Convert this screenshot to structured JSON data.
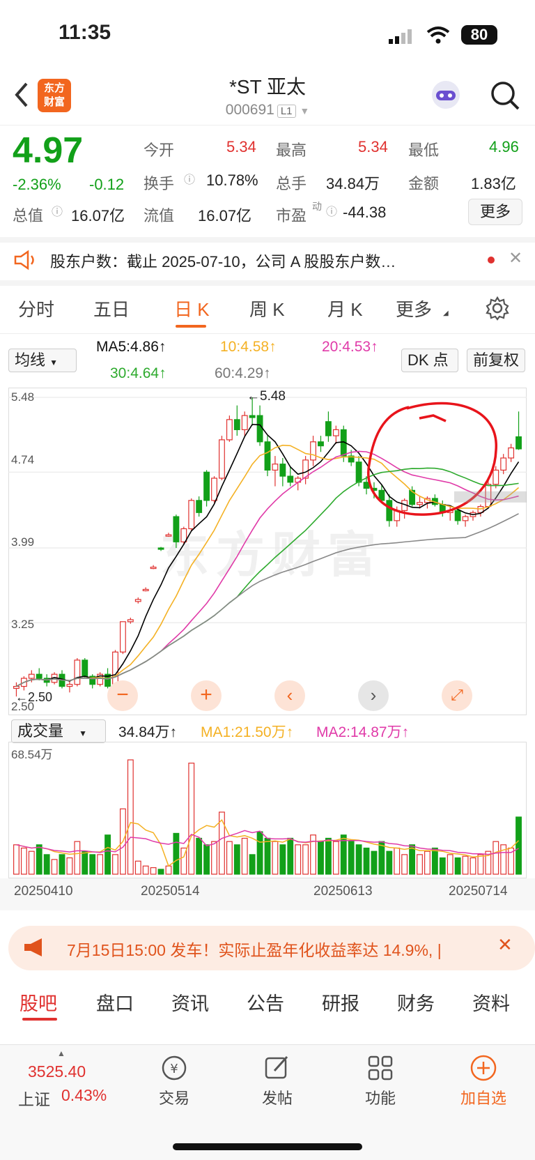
{
  "status_bar": {
    "time": "11:35",
    "battery": "80"
  },
  "header": {
    "logo_text": "东方\n财富",
    "title": "*ST 亚太",
    "code": "000691",
    "level": "L1"
  },
  "quote": {
    "price": "4.97",
    "change_pct": "-2.36%",
    "change": "-0.12",
    "open_label": "今开",
    "open": "5.34",
    "high_label": "最高",
    "high": "5.34",
    "low_label": "最低",
    "low": "4.96",
    "turnover_label": "换手",
    "turnover": "10.78%",
    "volume_label": "总手",
    "volume": "34.84万",
    "amount_label": "金额",
    "amount": "1.83亿",
    "mcap_label": "总值",
    "mcap": "16.07亿",
    "float_label": "流值",
    "float": "16.07亿",
    "pe_label": "市盈",
    "pe_sup": "动",
    "pe": "-44.38",
    "more": "更多"
  },
  "notice": {
    "text": "股东户数：截止 2025-07-10，公司 A 股股东户数…"
  },
  "period_tabs": [
    "分时",
    "五日",
    "日 K",
    "周 K",
    "月 K",
    "更多"
  ],
  "period_active": "日 K",
  "ma": {
    "selector": "均线",
    "ma5": "MA5:4.86↑",
    "ma10": "10:4.58↑",
    "ma20": "20:4.53↑",
    "ma30": "30:4.64↑",
    "ma60": "60:4.29↑",
    "dk": "DK 点",
    "adjust": "前复权"
  },
  "price_axis": [
    "5.48",
    "4.74",
    "3.99",
    "3.25",
    "2.50"
  ],
  "peak_label": "←5.48",
  "low_label": "←2.50",
  "watermark": "东方财富",
  "volume": {
    "selector": "成交量",
    "value": "34.84万↑",
    "ma1": "MA1:21.50万↑",
    "ma2": "MA2:14.87万↑",
    "max": "68.54万"
  },
  "dates": [
    "20250410",
    "20250514",
    "20250613",
    "20250714"
  ],
  "promo": {
    "text": "7月15日15:00 发车！实际止盈年化收益率达 14.9%, |"
  },
  "bottom_tabs": [
    "股吧",
    "盘口",
    "资讯",
    "公告",
    "研报",
    "财务",
    "资料"
  ],
  "bottom_active": "股吧",
  "bottom_nav": {
    "index_value": "3525.40",
    "index_name": "上证",
    "index_change": "0.43%",
    "items": [
      "交易",
      "发帖",
      "功能",
      "加自选"
    ]
  },
  "colors": {
    "up": "#e0312f",
    "down": "#12a019",
    "accent": "#f2661f",
    "ma5": "#000000",
    "ma10": "#f4b124",
    "ma20": "#e03aa8",
    "ma30": "#2daa2d",
    "ma60": "#888888"
  },
  "chart_data": {
    "type": "candlestick",
    "price_range": [
      2.5,
      5.48
    ],
    "candles": [
      [
        2.6,
        2.66,
        2.52,
        2.62
      ],
      [
        2.62,
        2.72,
        2.58,
        2.7
      ],
      [
        2.7,
        2.78,
        2.66,
        2.74
      ],
      [
        2.74,
        2.8,
        2.68,
        2.7
      ],
      [
        2.7,
        2.74,
        2.62,
        2.66
      ],
      [
        2.66,
        2.76,
        2.64,
        2.74
      ],
      [
        2.74,
        2.78,
        2.6,
        2.62
      ],
      [
        2.62,
        2.68,
        2.56,
        2.64
      ],
      [
        2.64,
        2.9,
        2.62,
        2.88
      ],
      [
        2.88,
        2.9,
        2.7,
        2.72
      ],
      [
        2.72,
        2.74,
        2.6,
        2.64
      ],
      [
        2.64,
        2.76,
        2.62,
        2.74
      ],
      [
        2.74,
        2.8,
        2.6,
        2.62
      ],
      [
        2.62,
        2.98,
        2.6,
        2.96
      ],
      [
        2.96,
        3.26,
        2.94,
        3.26
      ],
      [
        3.26,
        3.3,
        3.24,
        3.28
      ],
      [
        3.46,
        3.5,
        3.44,
        3.48
      ],
      [
        3.58,
        3.6,
        3.56,
        3.58
      ],
      [
        3.8,
        3.82,
        3.78,
        3.8
      ],
      [
        3.99,
        4.0,
        3.96,
        3.98
      ],
      [
        4.12,
        4.14,
        4.1,
        4.12
      ],
      [
        4.3,
        4.32,
        3.99,
        4.05
      ],
      [
        4.05,
        4.2,
        4.02,
        4.18
      ],
      [
        4.18,
        4.48,
        4.16,
        4.46
      ],
      [
        4.46,
        4.5,
        4.3,
        4.34
      ],
      [
        4.74,
        4.76,
        4.4,
        4.46
      ],
      [
        4.46,
        4.7,
        4.44,
        4.68
      ],
      [
        4.68,
        5.1,
        4.66,
        5.06
      ],
      [
        5.06,
        5.3,
        5.04,
        5.26
      ],
      [
        5.26,
        5.4,
        5.1,
        5.16
      ],
      [
        5.16,
        5.34,
        5.1,
        5.3
      ],
      [
        5.3,
        5.48,
        5.2,
        5.28
      ],
      [
        5.3,
        5.4,
        5.0,
        5.04
      ],
      [
        5.04,
        5.1,
        4.7,
        4.76
      ],
      [
        4.76,
        4.9,
        4.6,
        4.82
      ],
      [
        4.82,
        4.88,
        4.6,
        4.7
      ],
      [
        4.7,
        4.8,
        4.6,
        4.64
      ],
      [
        4.64,
        4.7,
        4.56,
        4.68
      ],
      [
        4.68,
        4.9,
        4.62,
        4.86
      ],
      [
        4.86,
        5.1,
        4.8,
        5.04
      ],
      [
        5.04,
        5.1,
        4.94,
        5.0
      ],
      [
        5.24,
        5.34,
        5.04,
        5.1
      ],
      [
        5.1,
        5.2,
        5.02,
        5.16
      ],
      [
        5.16,
        5.2,
        4.84,
        4.9
      ],
      [
        4.9,
        4.96,
        4.8,
        4.84
      ],
      [
        4.84,
        4.9,
        4.6,
        4.64
      ],
      [
        4.64,
        4.7,
        4.52,
        4.58
      ],
      [
        4.58,
        4.64,
        4.48,
        4.56
      ],
      [
        4.56,
        4.62,
        4.44,
        4.46
      ],
      [
        4.46,
        4.52,
        4.2,
        4.26
      ],
      [
        4.26,
        4.4,
        4.2,
        4.36
      ],
      [
        4.36,
        4.48,
        4.28,
        4.46
      ],
      [
        4.56,
        4.6,
        4.4,
        4.42
      ],
      [
        4.42,
        4.5,
        4.38,
        4.44
      ],
      [
        4.44,
        4.5,
        4.38,
        4.48
      ],
      [
        4.48,
        4.52,
        4.4,
        4.42
      ],
      [
        4.42,
        4.46,
        4.3,
        4.34
      ],
      [
        4.34,
        4.4,
        4.26,
        4.36
      ],
      [
        4.36,
        4.4,
        4.22,
        4.26
      ],
      [
        4.26,
        4.32,
        4.2,
        4.3
      ],
      [
        4.3,
        4.36,
        4.26,
        4.34
      ],
      [
        4.34,
        4.42,
        4.3,
        4.4
      ],
      [
        4.4,
        4.66,
        4.38,
        4.62
      ],
      [
        4.62,
        4.8,
        4.58,
        4.76
      ],
      [
        4.76,
        4.92,
        4.72,
        4.88
      ],
      [
        4.88,
        5.02,
        4.84,
        4.98
      ],
      [
        5.09,
        5.34,
        4.96,
        4.97
      ]
    ],
    "volumes": [
      18,
      16,
      14,
      18,
      12,
      9,
      12,
      10,
      20,
      14,
      12,
      12,
      24,
      12,
      40,
      70,
      8,
      5,
      4,
      3,
      5,
      25,
      16,
      68,
      22,
      18,
      20,
      38,
      20,
      18,
      22,
      12,
      26,
      22,
      20,
      18,
      22,
      18,
      18,
      24,
      20,
      22,
      20,
      24,
      20,
      18,
      16,
      14,
      20,
      14,
      16,
      12,
      18,
      12,
      14,
      16,
      10,
      12,
      10,
      11,
      10,
      12,
      14,
      20,
      18,
      16,
      35
    ]
  }
}
